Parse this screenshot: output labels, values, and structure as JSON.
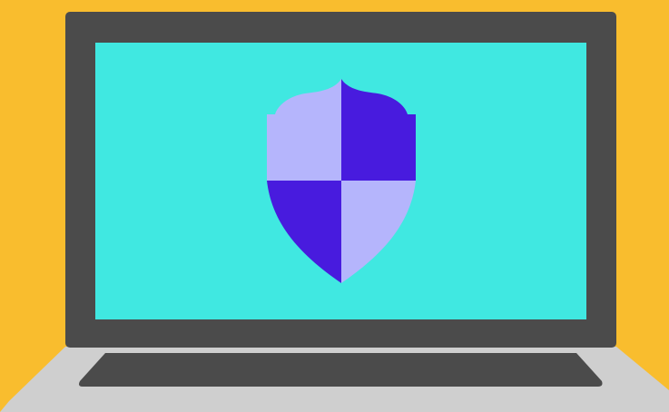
{
  "scene": {
    "subject": "laptop-with-security-shield",
    "colors": {
      "background": "#F9BD2E",
      "laptop_bezel": "#4B4B4B",
      "laptop_base": "#CFCFCF",
      "keyboard_area": "#4B4B4B",
      "screen": "#40E8E1",
      "shield_light": "#B5B5FC",
      "shield_dark": "#481BDE"
    },
    "icons": [
      "laptop-icon",
      "shield-icon"
    ]
  }
}
